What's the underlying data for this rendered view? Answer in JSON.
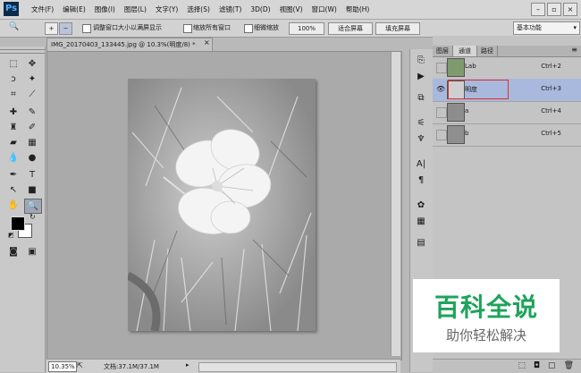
{
  "app": {
    "logo": "Ps"
  },
  "menu": [
    "文件(F)",
    "编辑(E)",
    "图像(I)",
    "图层(L)",
    "文字(Y)",
    "选择(S)",
    "滤镜(T)",
    "3D(D)",
    "视图(V)",
    "窗口(W)",
    "帮助(H)"
  ],
  "window_controls": {
    "minimize": "–",
    "restore": "▫",
    "close": "×"
  },
  "options": {
    "tool_glyph": "🔍",
    "resize_windows": "调整窗口大小以满屏显示",
    "zoom_all": "缩放所有窗口",
    "scrubby": "细微缩放",
    "zoom100": "100%",
    "fit_screen": "适合屏幕",
    "fill_screen": "填充屏幕",
    "workspace": "基本功能"
  },
  "document": {
    "tab_title": "IMG_20170403_133445.jpg @ 10.3%(明度/8) *",
    "tab_close": "×",
    "zoom": "10.35%",
    "info": "文档:37.1M/37.1M"
  },
  "panel": {
    "tabs": [
      "图层",
      "通道",
      "路径"
    ],
    "active_tab": 1,
    "channels": [
      {
        "name": "Lab",
        "shortcut": "Ctrl+2",
        "visible": false,
        "selected": false
      },
      {
        "name": "明度",
        "shortcut": "Ctrl+3",
        "visible": true,
        "selected": true
      },
      {
        "name": "a",
        "shortcut": "Ctrl+4",
        "visible": false,
        "selected": false
      },
      {
        "name": "b",
        "shortcut": "Ctrl+5",
        "visible": false,
        "selected": false
      }
    ]
  },
  "watermark": {
    "title": "百科全说",
    "subtitle": "助你轻松解决"
  },
  "colors": {
    "selection": "#a9b9dd",
    "highlight_box": "#e0302a",
    "watermark_green": "#1ea35a"
  }
}
